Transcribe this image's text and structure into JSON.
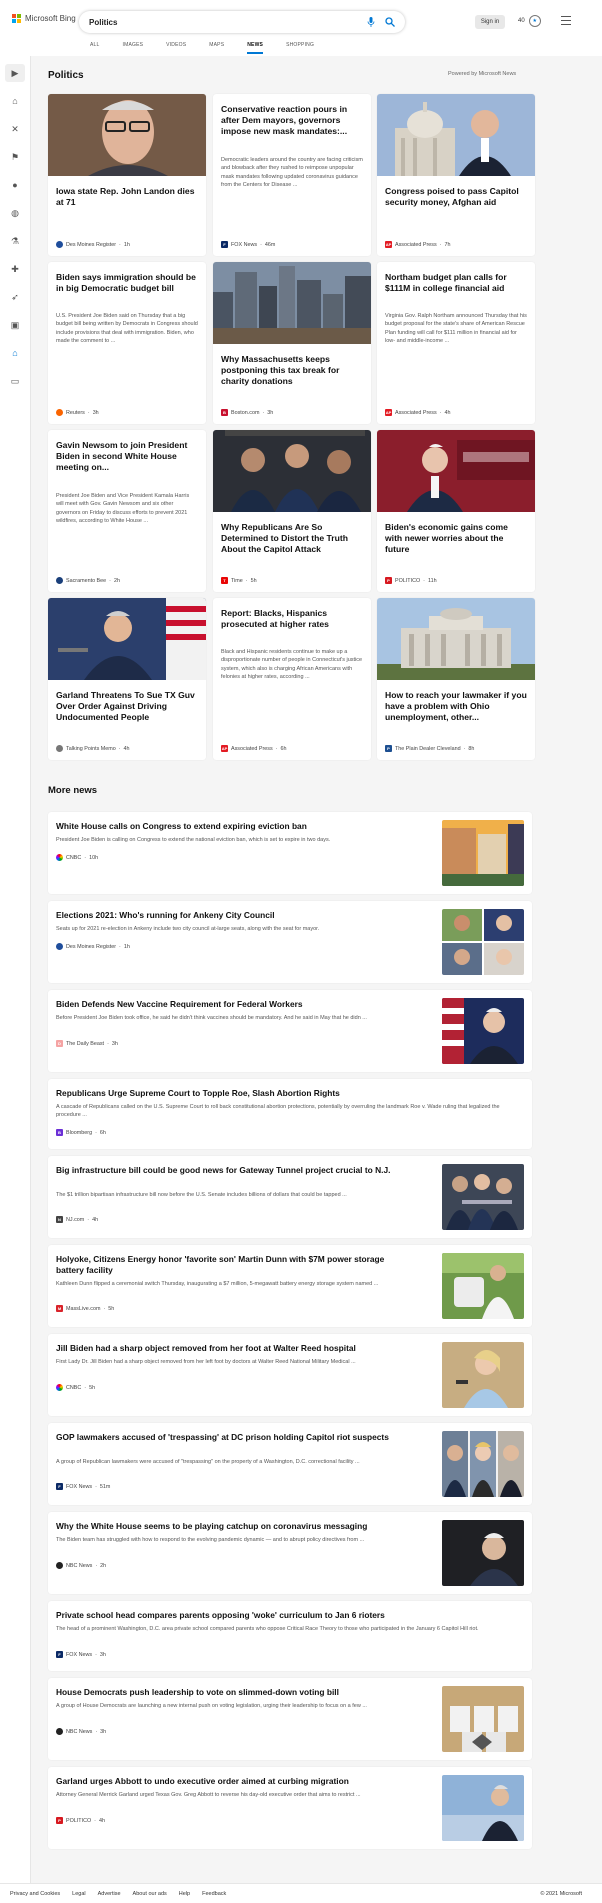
{
  "brand": {
    "name": "Microsoft Bing",
    "colors": [
      "#f25022",
      "#7fba00",
      "#00a4ef",
      "#ffb900"
    ]
  },
  "search": {
    "query": "Politics"
  },
  "header": {
    "signin_label": "Sign in",
    "rewards_count": "40"
  },
  "tabs": [
    {
      "label": "ALL"
    },
    {
      "label": "IMAGES"
    },
    {
      "label": "VIDEOS"
    },
    {
      "label": "MAPS"
    },
    {
      "label": "NEWS"
    },
    {
      "label": "SHOPPING"
    }
  ],
  "active_tab": "NEWS",
  "accent": "#0078d4",
  "section": {
    "title": "Politics",
    "powered_by": "Powered by Microsoft News"
  },
  "top_stories": [
    {
      "title": "Iowa state Rep. John Landon dies at 71",
      "snippet": "",
      "source": "Des Moines Register",
      "age": "1h"
    },
    {
      "title": "Conservative reaction pours in after Dem mayors, governors impose new mask mandates:...",
      "snippet": "Democratic leaders around the country are facing criticism and blowback after they rushed to reimpose unpopular mask mandates following updated coronavirus guidance from the Centers for Disease ...",
      "source": "FOX News",
      "age": "46m"
    },
    {
      "title": "Congress poised to pass Capitol security money, Afghan aid",
      "snippet": "",
      "source": "Associated Press",
      "age": "7h"
    },
    {
      "title": "Biden says immigration should be in big Democratic budget bill",
      "snippet": "U.S. President Joe Biden said on Thursday that a big budget bill being written by Democrats in Congress should include provisions that deal with immigration. Biden, who made the comment to ...",
      "source": "Reuters",
      "age": "3h"
    },
    {
      "title": "Why Massachusetts keeps postponing this tax break for charity donations",
      "snippet": "",
      "source": "Boston.com",
      "age": "3h"
    },
    {
      "title": "Northam budget plan calls for $111M in college financial aid",
      "snippet": "Virginia Gov. Ralph Northam announced Thursday that his budget proposal for the state's share of American Rescue Plan funding will call for $111 million in financial aid for low- and middle-income ...",
      "source": "Associated Press",
      "age": "4h"
    },
    {
      "title": "Gavin Newsom to join President Biden in second White House meeting on...",
      "snippet": "President Joe Biden and Vice President Kamala Harris will meet with Gov. Gavin Newsom and six other governors on Friday to discuss efforts to prevent 2021 wildfires, according to White House ...",
      "source": "Sacramento Bee",
      "age": "2h"
    },
    {
      "title": "Why Republicans Are So Determined to Distort the Truth About the Capitol Attack",
      "snippet": "",
      "source": "Time",
      "age": "5h"
    },
    {
      "title": "Biden's economic gains come with newer worries about the future",
      "snippet": "",
      "source": "POLITICO",
      "age": "11h"
    },
    {
      "title": "Garland Threatens To Sue TX Guv Over Order Against Driving Undocumented People",
      "snippet": "",
      "source": "Talking Points Memo",
      "age": "4h"
    },
    {
      "title": "Report: Blacks, Hispanics prosecuted at higher rates",
      "snippet": "Black and Hispanic residents continue to make up a disproportionate number of people in Connecticut's justice system, which also is charging African Americans with felonies at higher rates, according ...",
      "source": "Associated Press",
      "age": "6h"
    },
    {
      "title": "How to reach your lawmaker if you have a problem with Ohio unemployment, other...",
      "snippet": "",
      "source": "The Plain Dealer Cleveland",
      "age": "8h"
    }
  ],
  "more_news_title": "More news",
  "more_news": [
    {
      "title": "White House calls on Congress to extend expiring eviction ban",
      "snippet": "President Joe Biden is calling on Congress to extend the national eviction ban, which is set to expire in two days.",
      "source": "CNBC",
      "age": "10h"
    },
    {
      "title": "Elections 2021: Who's running for Ankeny City Council",
      "snippet": "Seats up for 2021 re-election in Ankeny include two city council at-large seats, along with the seat for mayor.",
      "source": "Des Moines Register",
      "age": "1h"
    },
    {
      "title": "Biden Defends New Vaccine Requirement for Federal Workers",
      "snippet": "Before President Joe Biden took office, he said he didn't think vaccines should be mandatory. And he said in May that he didn ...",
      "source": "The Daily Beast",
      "age": "3h"
    },
    {
      "title": "Republicans Urge Supreme Court to Topple Roe, Slash Abortion Rights",
      "snippet": "A cascade of Republicans called on the U.S. Supreme Court to roll back constitutional abortion protections, potentially by overruling the landmark Roe v. Wade ruling that legalized the procedure ...",
      "source": "Bloomberg",
      "age": "6h"
    },
    {
      "title": "Big infrastructure bill could be good news for Gateway Tunnel project crucial to N.J.",
      "snippet": "The $1 trillion bipartisan infrastructure bill now before the U.S. Senate includes billions of dollars that could be tapped ...",
      "source": "NJ.com",
      "age": "4h"
    },
    {
      "title": "Holyoke, Citizens Energy honor 'favorite son' Martin Dunn with $7M power storage battery facility",
      "snippet": "Kathleen Dunn flipped a ceremonial switch Thursday, inaugurating a $7 million, 5-megawatt battery energy storage system named ...",
      "source": "MassLive.com",
      "age": "5h"
    },
    {
      "title": "Jill Biden had a sharp object removed from her foot at Walter Reed hospital",
      "snippet": "First Lady Dr. Jill Biden had a sharp object removed from her left foot by doctors at Walter Reed National Military Medical ...",
      "source": "CNBC",
      "age": "5h"
    },
    {
      "title": "GOP lawmakers accused of 'trespassing' at DC prison holding Capitol riot suspects",
      "snippet": "A group of Republican lawmakers were accused of \"trespassing\" on the property of a Washington, D.C. correctional facility ...",
      "source": "FOX News",
      "age": "51m"
    },
    {
      "title": "Why the White House seems to be playing catchup on coronavirus messaging",
      "snippet": "The Biden team has struggled with how to respond to the evolving pandemic dynamic — and to abrupt policy directives from ...",
      "source": "NBC News",
      "age": "2h"
    },
    {
      "title": "Private school head compares parents opposing 'woke' curriculum to Jan 6 rioters",
      "snippet": "The head of a prominent Washington, D.C. area private school compared parents who oppose Critical Race Theory to those who participated in the January 6 Capitol Hill riot.",
      "source": "FOX News",
      "age": "3h"
    },
    {
      "title": "House Democrats push leadership to vote on slimmed-down voting bill",
      "snippet": "A group of House Democrats are launching a new internal push on voting legislation, urging their leadership to focus on a few ...",
      "source": "NBC News",
      "age": "3h"
    },
    {
      "title": "Garland urges Abbott to undo executive order aimed at curbing migration",
      "snippet": "Attorney General Merrick Garland urged Texas Gov. Greg Abbott to reverse his day-old executive order that aims to restrict ...",
      "source": "POLITICO",
      "age": "4h"
    }
  ],
  "footer": {
    "links": [
      "Privacy and Cookies",
      "Legal",
      "Advertise",
      "About our ads",
      "Help",
      "Feedback"
    ],
    "copyright": "© 2021 Microsoft"
  }
}
